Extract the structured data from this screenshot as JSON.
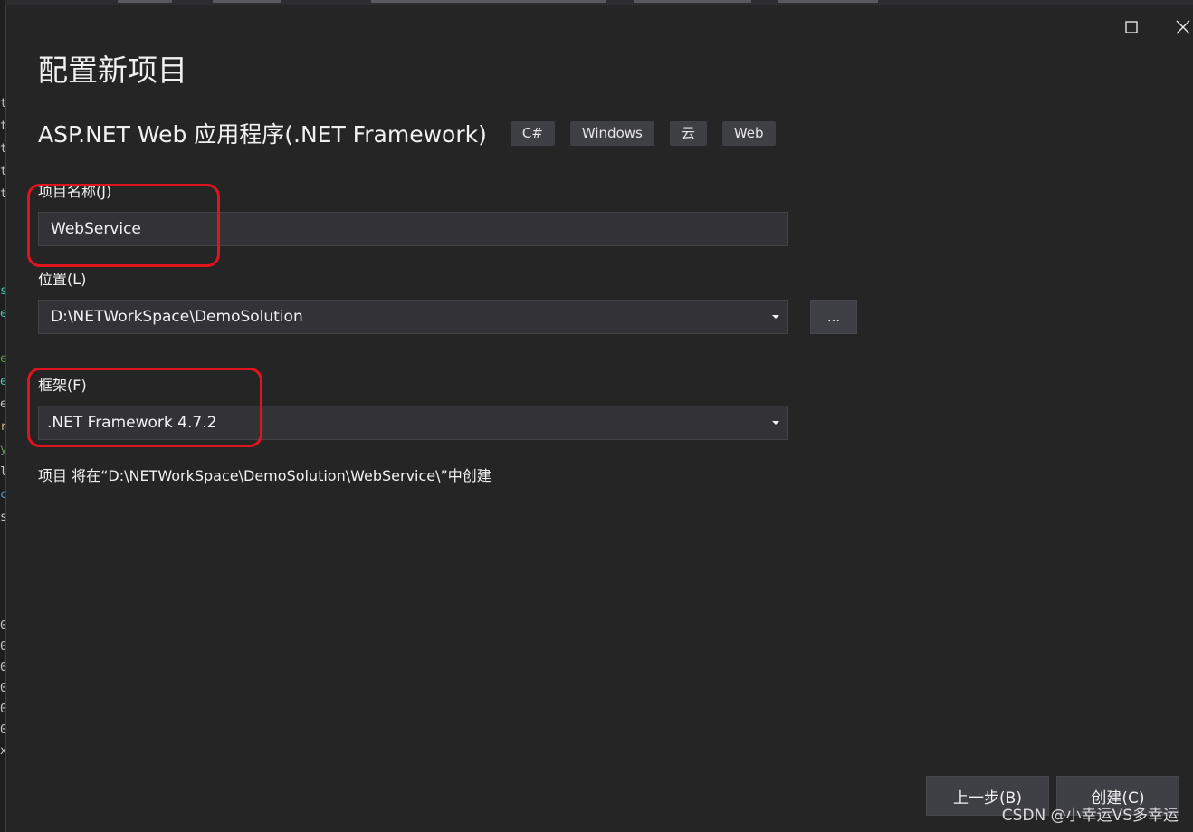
{
  "dialog": {
    "title": "配置新项目",
    "template_name": "ASP.NET Web 应用程序(.NET Framework)",
    "tags": [
      "C#",
      "Windows",
      "云",
      "Web"
    ]
  },
  "project_name": {
    "label": "项目名称(J)",
    "value": "WebService"
  },
  "location": {
    "label": "位置(L)",
    "value": "D:\\NETWorkSpace\\DemoSolution",
    "browse_label": "..."
  },
  "framework": {
    "label": "框架(F)",
    "value": ".NET Framework 4.7.2"
  },
  "info_text": "项目 将在“D:\\NETWorkSpace\\DemoSolution\\WebService\\”中创建",
  "buttons": {
    "back": "上一步(B)",
    "create": "创建(C)"
  },
  "watermark": "CSDN @小幸运VS多幸运",
  "colors": {
    "background": "#252526",
    "input_bg": "#333337",
    "button_bg": "#3f3f46",
    "annotation": "#e0141e"
  },
  "icons": {
    "maximize": "maximize-icon",
    "close": "close-icon",
    "dropdown": "chevron-down-icon"
  }
}
